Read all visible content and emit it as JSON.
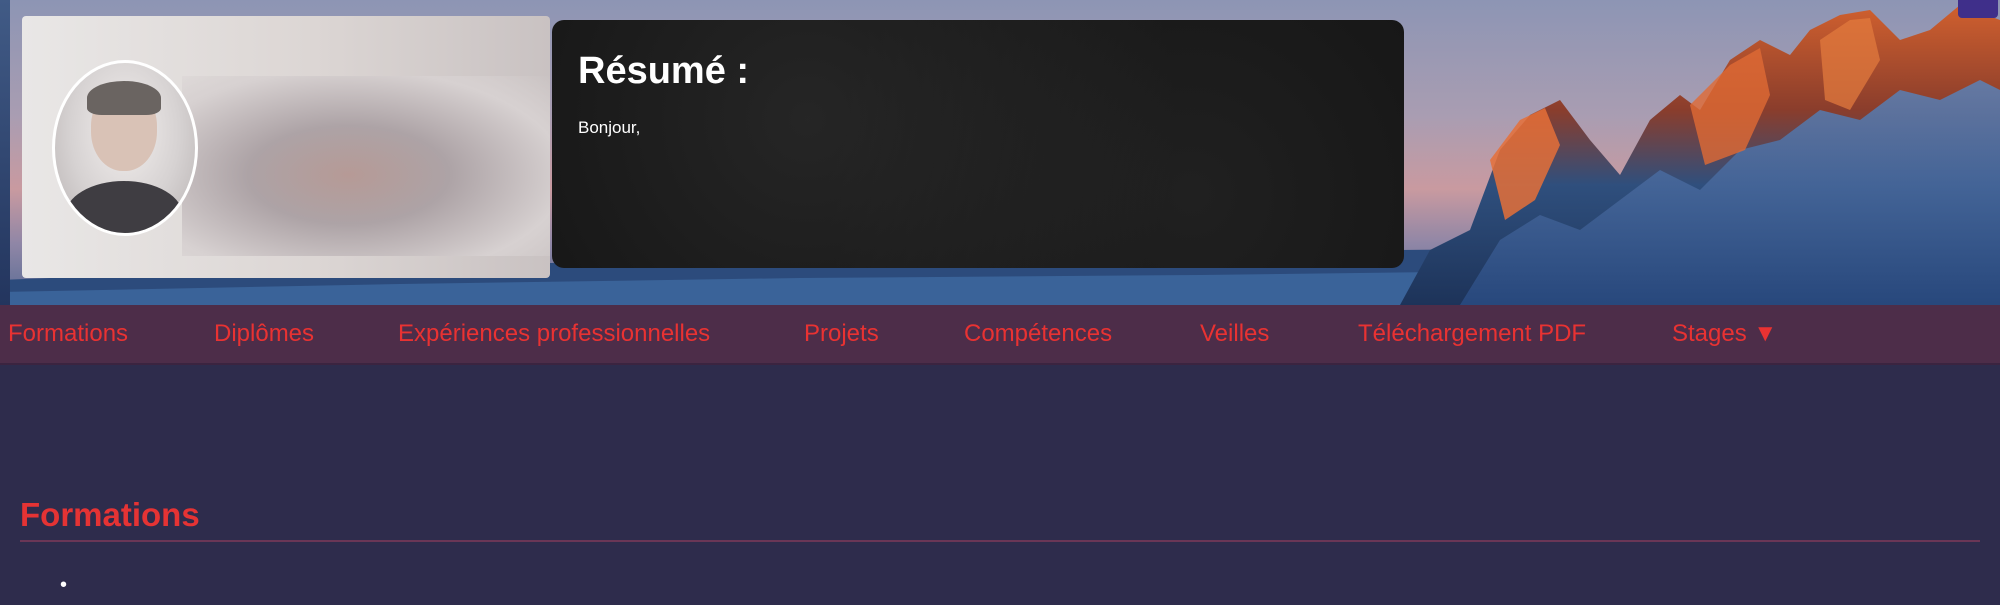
{
  "header": {
    "name": "",
    "taglines": [
      "",
      "",
      ""
    ]
  },
  "resume": {
    "title": "Résumé :",
    "lines": [
      "Bonjour,",
      "",
      "",
      ""
    ]
  },
  "nav": {
    "items": [
      "Formations",
      "Diplômes",
      "Expériences professionnelles",
      "Projets",
      "Compétences",
      "Veilles",
      "Téléchargement PDF",
      "Stages ▼"
    ]
  },
  "main": {
    "section_title": "Formations",
    "items": [
      ""
    ]
  },
  "colors": {
    "accent": "#e53334",
    "nav_bg": "#4d2d49",
    "page_bg": "#2e2c4c"
  }
}
